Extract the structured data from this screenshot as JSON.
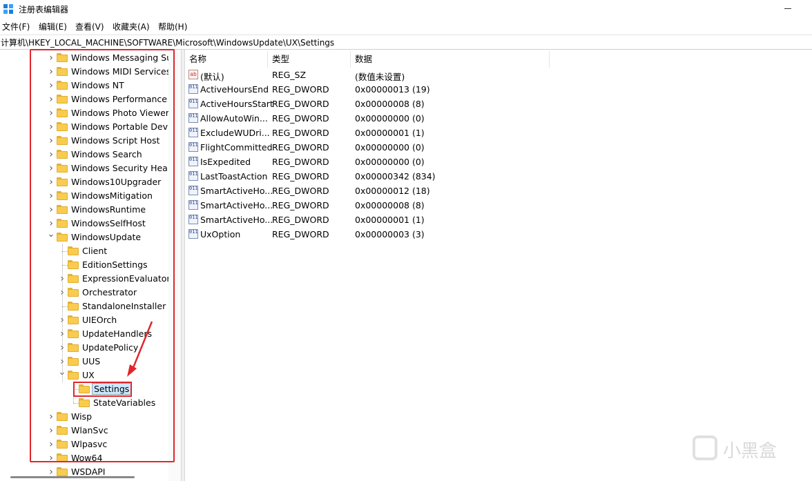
{
  "window": {
    "title": "注册表编辑器"
  },
  "menu": [
    "文件(F)",
    "编辑(E)",
    "查看(V)",
    "收藏夹(A)",
    "帮助(H)"
  ],
  "address": "计算机\\HKEY_LOCAL_MACHINE\\SOFTWARE\\Microsoft\\WindowsUpdate\\UX\\Settings",
  "tree": [
    {
      "label": "Windows Messaging Su",
      "level": 0,
      "state": "collapsed"
    },
    {
      "label": "Windows MIDI Services",
      "level": 0,
      "state": "collapsed"
    },
    {
      "label": "Windows NT",
      "level": 0,
      "state": "collapsed"
    },
    {
      "label": "Windows Performance T",
      "level": 0,
      "state": "collapsed"
    },
    {
      "label": "Windows Photo Viewer",
      "level": 0,
      "state": "collapsed"
    },
    {
      "label": "Windows Portable Devic",
      "level": 0,
      "state": "collapsed"
    },
    {
      "label": "Windows Script Host",
      "level": 0,
      "state": "collapsed"
    },
    {
      "label": "Windows Search",
      "level": 0,
      "state": "collapsed"
    },
    {
      "label": "Windows Security Health",
      "level": 0,
      "state": "collapsed"
    },
    {
      "label": "Windows10Upgrader",
      "level": 0,
      "state": "collapsed"
    },
    {
      "label": "WindowsMitigation",
      "level": 0,
      "state": "collapsed"
    },
    {
      "label": "WindowsRuntime",
      "level": 0,
      "state": "collapsed"
    },
    {
      "label": "WindowsSelfHost",
      "level": 0,
      "state": "collapsed"
    },
    {
      "label": "WindowsUpdate",
      "level": 0,
      "state": "expanded"
    },
    {
      "label": "Client",
      "level": 1,
      "state": "leaf"
    },
    {
      "label": "EditionSettings",
      "level": 1,
      "state": "leaf"
    },
    {
      "label": "ExpressionEvaluators",
      "level": 1,
      "state": "collapsed"
    },
    {
      "label": "Orchestrator",
      "level": 1,
      "state": "collapsed"
    },
    {
      "label": "StandaloneInstaller",
      "level": 1,
      "state": "leaf"
    },
    {
      "label": "UIEOrch",
      "level": 1,
      "state": "collapsed"
    },
    {
      "label": "UpdateHandlers",
      "level": 1,
      "state": "collapsed"
    },
    {
      "label": "UpdatePolicy",
      "level": 1,
      "state": "collapsed"
    },
    {
      "label": "UUS",
      "level": 1,
      "state": "collapsed"
    },
    {
      "label": "UX",
      "level": 1,
      "state": "expanded"
    },
    {
      "label": "Settings",
      "level": 2,
      "state": "leaf",
      "selected": true
    },
    {
      "label": "StateVariables",
      "level": 2,
      "state": "leaf"
    },
    {
      "label": "Wisp",
      "level": 0,
      "state": "collapsed"
    },
    {
      "label": "WlanSvc",
      "level": 0,
      "state": "collapsed"
    },
    {
      "label": "Wlpasvc",
      "level": 0,
      "state": "collapsed"
    },
    {
      "label": "Wow64",
      "level": 0,
      "state": "collapsed"
    },
    {
      "label": "WSDAPI",
      "level": 0,
      "state": "collapsed"
    }
  ],
  "columns": [
    "名称",
    "类型",
    "数据"
  ],
  "values": [
    {
      "name": "(默认)",
      "type": "REG_SZ",
      "data": "(数值未设置)",
      "icon": "string-value-icon"
    },
    {
      "name": "ActiveHoursEnd",
      "type": "REG_DWORD",
      "data": "0x00000013 (19)",
      "icon": "dword-value-icon"
    },
    {
      "name": "ActiveHoursStart",
      "type": "REG_DWORD",
      "data": "0x00000008 (8)",
      "icon": "dword-value-icon"
    },
    {
      "name": "AllowAutoWin...",
      "type": "REG_DWORD",
      "data": "0x00000000 (0)",
      "icon": "dword-value-icon"
    },
    {
      "name": "ExcludeWUDri...",
      "type": "REG_DWORD",
      "data": "0x00000001 (1)",
      "icon": "dword-value-icon"
    },
    {
      "name": "FlightCommitted",
      "type": "REG_DWORD",
      "data": "0x00000000 (0)",
      "icon": "dword-value-icon"
    },
    {
      "name": "IsExpedited",
      "type": "REG_DWORD",
      "data": "0x00000000 (0)",
      "icon": "dword-value-icon"
    },
    {
      "name": "LastToastAction",
      "type": "REG_DWORD",
      "data": "0x00000342 (834)",
      "icon": "dword-value-icon"
    },
    {
      "name": "SmartActiveHo...",
      "type": "REG_DWORD",
      "data": "0x00000012 (18)",
      "icon": "dword-value-icon"
    },
    {
      "name": "SmartActiveHo...",
      "type": "REG_DWORD",
      "data": "0x00000008 (8)",
      "icon": "dword-value-icon"
    },
    {
      "name": "SmartActiveHo...",
      "type": "REG_DWORD",
      "data": "0x00000001 (1)",
      "icon": "dword-value-icon"
    },
    {
      "name": "UxOption",
      "type": "REG_DWORD",
      "data": "0x00000003 (3)",
      "icon": "dword-value-icon"
    }
  ],
  "watermark": {
    "text": "小黑盒"
  },
  "colors": {
    "annotation_red": "#e0262b",
    "selection": "#cce8ff",
    "folder": "#f9cc4f"
  }
}
